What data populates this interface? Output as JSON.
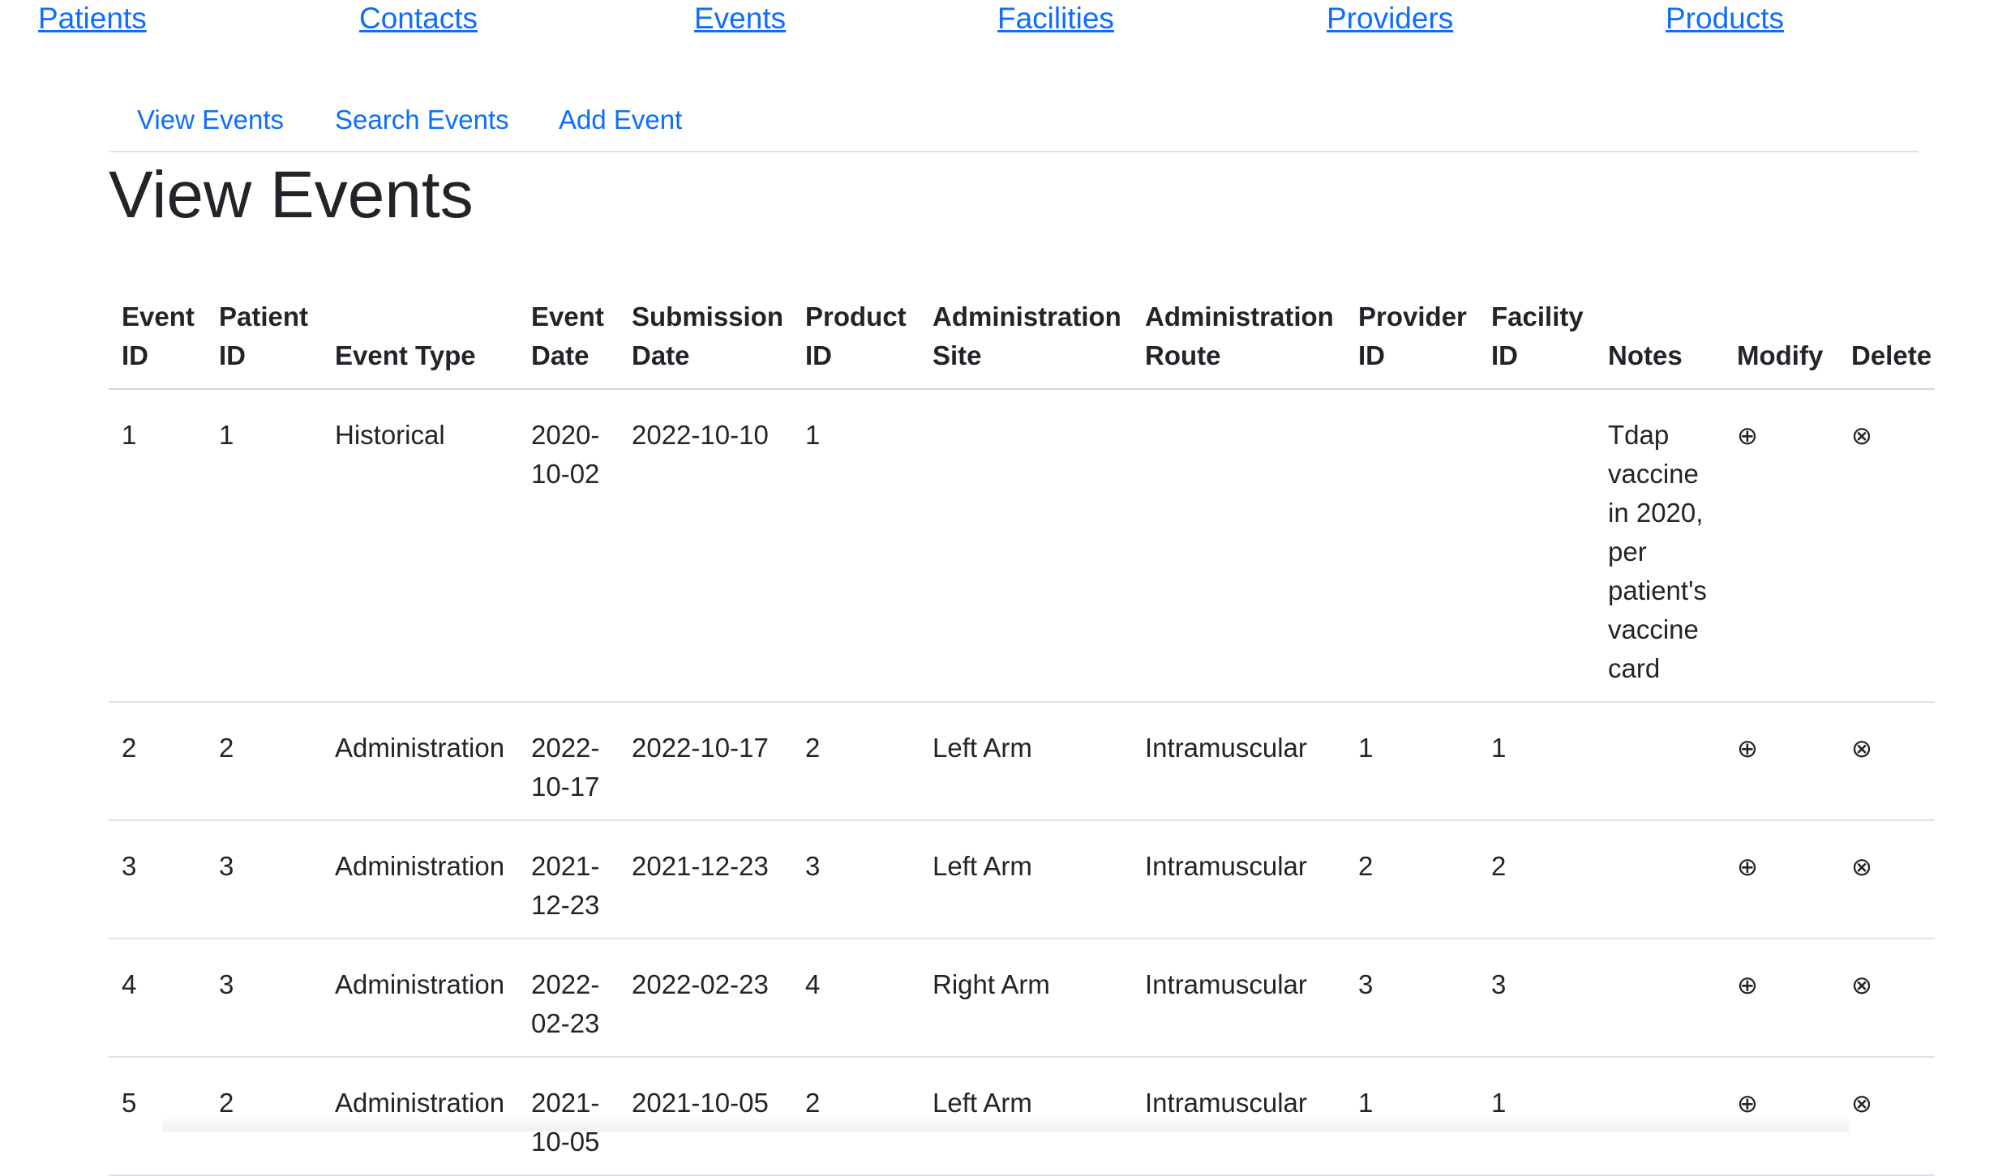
{
  "top_nav": {
    "patients": "Patients",
    "contacts": "Contacts",
    "events": "Events",
    "facilities": "Facilities",
    "providers": "Providers",
    "products": "Products"
  },
  "sub_nav": {
    "view_events": "View Events",
    "search_events": "Search Events",
    "add_event": "Add Event"
  },
  "page_title": "View Events",
  "table": {
    "headers": {
      "event_id": "Event ID",
      "patient_id": "Patient ID",
      "event_type": "Event Type",
      "event_date": "Event Date",
      "submission_date": "Submission Date",
      "product_id": "Product ID",
      "administration_site": "Administration Site",
      "administration_route": "Administration Route",
      "provider_id": "Provider ID",
      "facility_id": "Facility ID",
      "notes": "Notes",
      "modify": "Modify",
      "delete": "Delete"
    },
    "icons": {
      "modify": "⊕",
      "delete": "⊗",
      "modify_icon_name": "circled-plus-icon",
      "delete_icon_name": "circled-x-icon"
    },
    "rows": [
      {
        "event_id": "1",
        "patient_id": "1",
        "event_type": "Historical",
        "event_date": "2020-10-02",
        "submission_date": "2022-10-10",
        "product_id": "1",
        "administration_site": "",
        "administration_route": "",
        "provider_id": "",
        "facility_id": "",
        "notes": "Tdap vaccine in 2020, per patient's vaccine card"
      },
      {
        "event_id": "2",
        "patient_id": "2",
        "event_type": "Administration",
        "event_date": "2022-10-17",
        "submission_date": "2022-10-17",
        "product_id": "2",
        "administration_site": "Left Arm",
        "administration_route": "Intramuscular",
        "provider_id": "1",
        "facility_id": "1",
        "notes": ""
      },
      {
        "event_id": "3",
        "patient_id": "3",
        "event_type": "Administration",
        "event_date": "2021-12-23",
        "submission_date": "2021-12-23",
        "product_id": "3",
        "administration_site": "Left Arm",
        "administration_route": "Intramuscular",
        "provider_id": "2",
        "facility_id": "2",
        "notes": ""
      },
      {
        "event_id": "4",
        "patient_id": "3",
        "event_type": "Administration",
        "event_date": "2022-02-23",
        "submission_date": "2022-02-23",
        "product_id": "4",
        "administration_site": "Right Arm",
        "administration_route": "Intramuscular",
        "provider_id": "3",
        "facility_id": "3",
        "notes": ""
      },
      {
        "event_id": "5",
        "patient_id": "2",
        "event_type": "Administration",
        "event_date": "2021-10-05",
        "submission_date": "2021-10-05",
        "product_id": "2",
        "administration_site": "Left Arm",
        "administration_route": "Intramuscular",
        "provider_id": "1",
        "facility_id": "1",
        "notes": ""
      }
    ]
  },
  "colors": {
    "link": "#0d6efd",
    "text": "#212529",
    "border": "#dee2e6"
  }
}
